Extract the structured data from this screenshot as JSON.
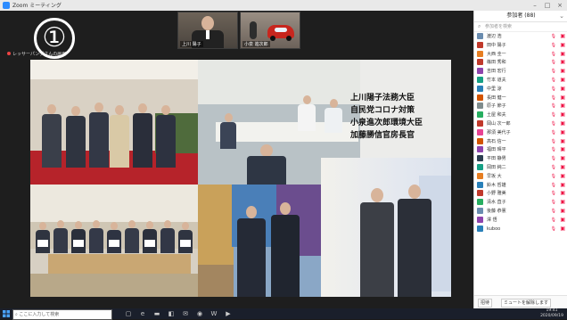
{
  "window": {
    "title": "Zoom ミーティング"
  },
  "share": {
    "label": "レッサーパンダさんの画面"
  },
  "overlay_number": "①",
  "thumbnails": [
    {
      "name": "上川 陽子"
    },
    {
      "name": "小泉 進次郎"
    }
  ],
  "slide": {
    "caption_lines": [
      "上川陽子法務大臣",
      "自民党コロナ対策",
      "小泉進次郎環境大臣",
      "加藤勝信官房長官"
    ]
  },
  "participants": {
    "header": "参加者 (88)",
    "search_placeholder": "参加者を検索",
    "items": [
      {
        "name": "渡辺 浩",
        "color": "#6a8caf"
      },
      {
        "name": "田中 陽子",
        "color": "#c0392b"
      },
      {
        "name": "大西 圭一",
        "color": "#e67e22"
      },
      {
        "name": "篠田 秀和",
        "color": "#c0392b"
      },
      {
        "name": "吉田 宏行",
        "color": "#8e44ad"
      },
      {
        "name": "竹本 道夫",
        "color": "#16a085"
      },
      {
        "name": "中里 涼",
        "color": "#2980b9"
      },
      {
        "name": "長田 健一",
        "color": "#d35400"
      },
      {
        "name": "原子 節子",
        "color": "#7f8c8d"
      },
      {
        "name": "土屋 和夫",
        "color": "#27ae60"
      },
      {
        "name": "岡山 次一郎",
        "color": "#c0392b"
      },
      {
        "name": "那須 美代子",
        "color": "#e84393"
      },
      {
        "name": "高石 信一",
        "color": "#d35400"
      },
      {
        "name": "福田 晴平",
        "color": "#8e44ad"
      },
      {
        "name": "平田 静男",
        "color": "#2c3e50"
      },
      {
        "name": "岡田 純二",
        "color": "#16a085"
      },
      {
        "name": "早坂 大",
        "color": "#e67e22"
      },
      {
        "name": "鈴木 哲雄",
        "color": "#2980b9"
      },
      {
        "name": "小野 雅美",
        "color": "#c0392b"
      },
      {
        "name": "清水 直子",
        "color": "#27ae60"
      },
      {
        "name": "後藤 恭憲",
        "color": "#6a8caf"
      },
      {
        "name": "澤 悟",
        "color": "#8e44ad"
      },
      {
        "name": "kuboo",
        "color": "#2980b9"
      }
    ],
    "invite_label": "招待",
    "unmute_label": "ミュートを解除します"
  },
  "taskbar": {
    "search_placeholder": "ここに入力して検索",
    "time": "19:41",
    "date": "2020/09/19"
  },
  "colors": {
    "accent": "#2d8cff",
    "muted_icon": "#e11d48"
  }
}
